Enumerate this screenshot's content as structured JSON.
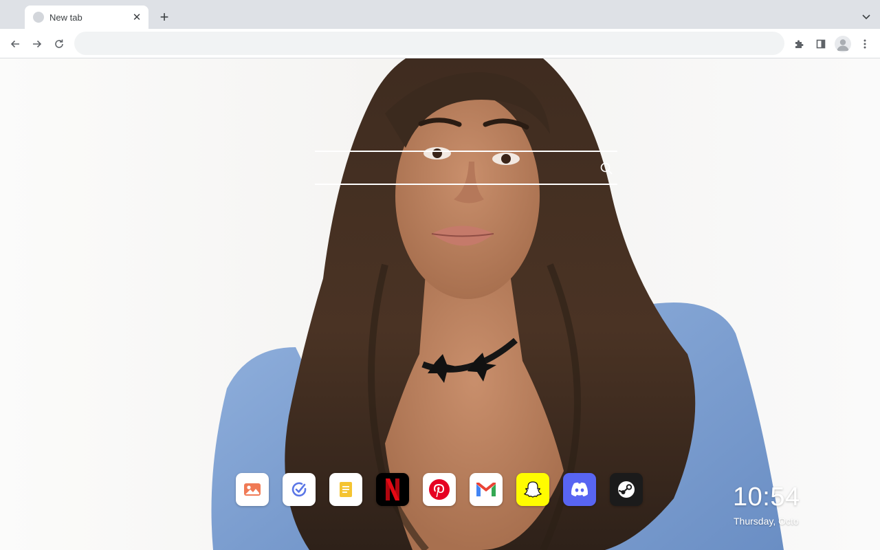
{
  "tab": {
    "title": "New tab",
    "close_glyph": "✕"
  },
  "tabstrip": {
    "new_tab_glyph": "+"
  },
  "omnibox": {
    "value": "",
    "placeholder": ""
  },
  "search": {
    "value": "",
    "placeholder": ""
  },
  "icons": {
    "back": "back-arrow-icon",
    "forward": "forward-arrow-icon",
    "reload": "reload-icon",
    "extensions": "puzzle-piece-icon",
    "side_panel": "side-panel-icon",
    "profile": "profile-avatar-icon",
    "menu": "kebab-menu-icon",
    "tab_search": "chevron-down-icon"
  },
  "shortcuts": [
    {
      "id": "photos",
      "icon": "photos-icon",
      "bg": "#ffffff"
    },
    {
      "id": "tasks",
      "icon": "checkmark-icon",
      "bg": "#ffffff"
    },
    {
      "id": "notes",
      "icon": "notes-icon",
      "bg": "#ffffff"
    },
    {
      "id": "netflix",
      "icon": "netflix-icon",
      "bg": "#000000"
    },
    {
      "id": "pinterest",
      "icon": "pinterest-icon",
      "bg": "#ffffff"
    },
    {
      "id": "gmail",
      "icon": "gmail-icon",
      "bg": "#ffffff"
    },
    {
      "id": "snapchat",
      "icon": "snapchat-icon",
      "bg": "#fffc00"
    },
    {
      "id": "discord",
      "icon": "discord-icon",
      "bg": "#5865f2"
    },
    {
      "id": "steam",
      "icon": "steam-icon",
      "bg": "#1b1b1b"
    }
  ],
  "clock": {
    "time": "10:54",
    "date": "Thursday, Octo"
  },
  "colors": {
    "tabstrip": "#dee1e6",
    "toolbar": "#ffffff",
    "omnibox": "#f1f3f4",
    "coat": "#7a9ccf",
    "hair": "#3a281c"
  }
}
